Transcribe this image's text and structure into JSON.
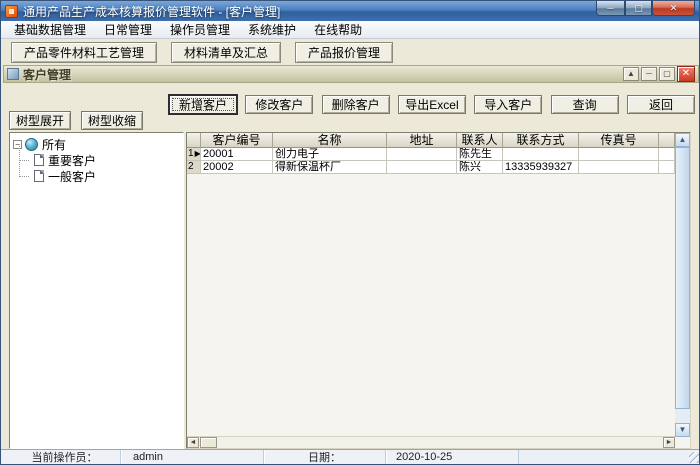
{
  "window": {
    "title": "通用产品生产成本核算报价管理软件  - [客户管理]"
  },
  "icons": {
    "minimize": "─",
    "maximize": "▢",
    "close": "✕",
    "child_rollup": "▲",
    "child_minimize": "─",
    "child_maximize": "▢",
    "child_close": "✕",
    "expand_box": "−",
    "scroll_left": "◄",
    "scroll_right": "►",
    "scroll_up": "▲",
    "scroll_down": "▼"
  },
  "menu": {
    "items": [
      "基础数据管理",
      "日常管理",
      "操作员管理",
      "系统维护",
      "在线帮助"
    ]
  },
  "toolbar": {
    "buttons": [
      "产品零件材料工艺管理",
      "材料清单及汇总",
      "产品报价管理"
    ]
  },
  "child_window": {
    "title": "客户管理"
  },
  "actions": {
    "buttons": [
      "新增客户",
      "修改客户",
      "删除客户",
      "导出Excel",
      "导入客户",
      "查询",
      "返回"
    ]
  },
  "tree_controls": {
    "expand": "树型展开",
    "collapse": "树型收缩"
  },
  "tree": {
    "root": "所有",
    "children": [
      "重要客户",
      "一般客户"
    ]
  },
  "table": {
    "columns": [
      "客户编号",
      "名称",
      "地址",
      "联系人",
      "联系方式",
      "传真号"
    ],
    "rows": [
      {
        "num": "1",
        "marker": "▶",
        "no": "20001",
        "name": "创力电子",
        "addr": "",
        "contact": "陈先生",
        "phone": "",
        "fax": ""
      },
      {
        "num": "2",
        "marker": "",
        "no": "20002",
        "name": "得新保温杯厂",
        "addr": "",
        "contact": "陈兴",
        "phone": "13335939327",
        "fax": ""
      }
    ]
  },
  "status_bar": {
    "operator_label": "当前操作员：",
    "operator_value": "admin",
    "date_label": "日期：",
    "date_value": "2020-10-25"
  },
  "colors": {
    "titlebar_blue": "#4a7fc1",
    "workspace_beige": "#ece9d8",
    "caption_olive": "#c2c2a0",
    "close_red": "#cc3a22",
    "scrollbar_blue": "#c2d7ec"
  }
}
